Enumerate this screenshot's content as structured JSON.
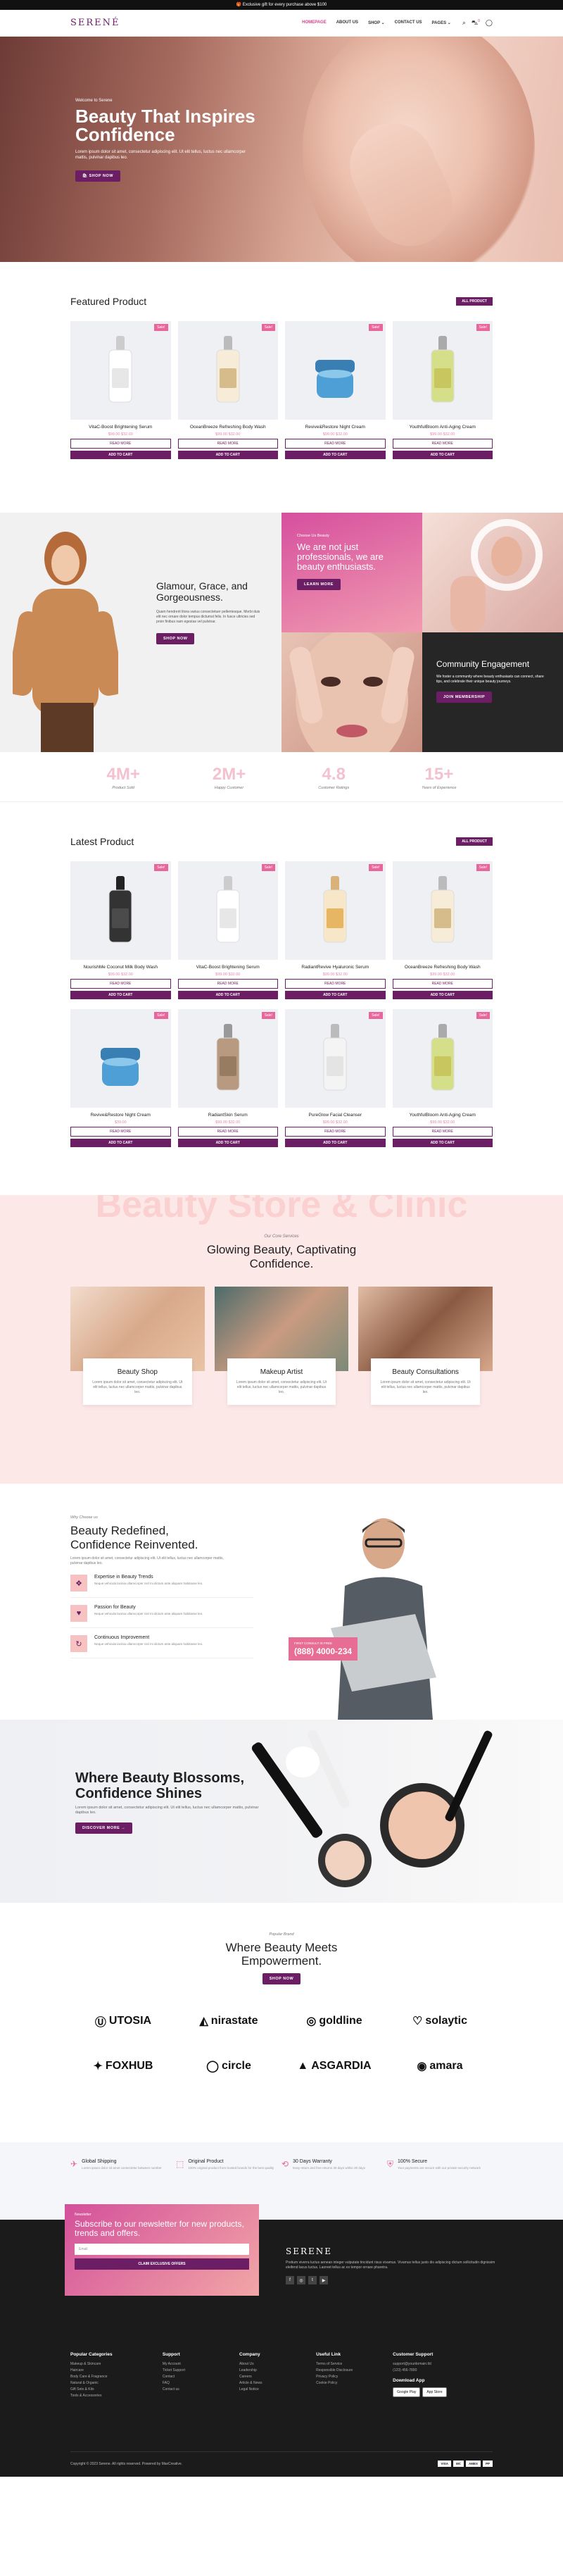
{
  "topbar": {
    "text": "Exclusive gift for every purchase above $100"
  },
  "header": {
    "logo": "SERENÉ",
    "nav": [
      "HOMEPAGE",
      "ABOUT US",
      "SHOP ⌄",
      "CONTACT US",
      "PAGES ⌄"
    ],
    "cart_count": "0"
  },
  "hero": {
    "welcome": "Welcome to Serene",
    "title": "Beauty That Inspires Confidence",
    "desc": "Lorem ipsum dolor sit amet, consectetur adipiscing elit. Ut elit tellus, luctus nec ullamcorper mattis, pulvinar dapibus leo.",
    "cta": "SHOP NOW"
  },
  "featured": {
    "title": "Featured Product",
    "all": "ALL PRODUCT",
    "products": [
      {
        "name": "VitaC-Boost Brightening Serum",
        "price": "$99.00 $32.00",
        "badge": "Sale!"
      },
      {
        "name": "OceanBreeze Refreshing Body Wash",
        "price": "$99.00 $32.00",
        "badge": "Sale!"
      },
      {
        "name": "Revive&Restore Night Cream",
        "price": "$99.00 $32.00",
        "badge": "Sale!"
      },
      {
        "name": "YouthfulBloom Anti-Aging Cream",
        "price": "$99.00 $32.00",
        "badge": "Sale!"
      }
    ],
    "read_more": "READ MORE",
    "add_to_cart": "ADD TO CART"
  },
  "promo": {
    "left_title": "Glamour, Grace, and Gorgeousness.",
    "left_desc": "Quam hendrerit litora varius consectetuer pellentesque. Morbi duis elit nec ornare dolor tempus dictumst felis. In fusce ultricies sed proin finibus nam egestas vel pulvinar.",
    "left_cta": "SHOP NOW",
    "a_small": "Choose Us Beauty",
    "a_title": "We are not just professionals, we are beauty enthusiasts.",
    "a_cta": "LEARN MORE",
    "d_title": "Community Engagement",
    "d_desc": "We foster a community where beauty enthusiasts can connect, share tips, and celebrate their unique beauty journeys.",
    "d_cta": "JOIN MEMBERSHIP"
  },
  "stats": [
    {
      "n": "4M+",
      "l": "Product Sold"
    },
    {
      "n": "2M+",
      "l": "Happy Customer"
    },
    {
      "n": "4.8",
      "l": "Customer Ratings"
    },
    {
      "n": "15+",
      "l": "Years of Experience"
    }
  ],
  "latest": {
    "title": "Latest Product",
    "all": "ALL PRODUCT",
    "products": [
      {
        "name": "NourishMe Coconut Milk Body Wash",
        "price": "$99.00 $32.00",
        "badge": "Sale!"
      },
      {
        "name": "VitaC-Boost Brightening Serum",
        "price": "$99.00 $32.00",
        "badge": "Sale!"
      },
      {
        "name": "RadiantRevive Hyaluronic Serum",
        "price": "$99.00 $32.00",
        "badge": "Sale!"
      },
      {
        "name": "OceanBreeze Refreshing Body Wash",
        "price": "$99.00 $32.00",
        "badge": "Sale!"
      },
      {
        "name": "Revive&Restore Night Cream",
        "price": "$39.00",
        "badge": "Sale!"
      },
      {
        "name": "RadiantSkin Serum",
        "price": "$99.00 $32.00",
        "badge": "Sale!"
      },
      {
        "name": "PureGlow Facial Cleanser",
        "price": "$99.00 $32.00",
        "badge": "Sale!"
      },
      {
        "name": "YouthfulBloom Anti-Aging Cream",
        "price": "$99.00 $32.00",
        "badge": "Sale!"
      }
    ],
    "read_more": "READ MORE",
    "add_to_cart": "ADD TO CART"
  },
  "clinic": {
    "ghost": "Beauty Store & Clinic",
    "sub": "Our Core Services",
    "title": "Glowing Beauty, Captivating Confidence.",
    "services": [
      {
        "name": "Beauty Shop",
        "desc": "Lorem ipsum dolor sit amet, consectetur adipiscing elit. Ut elit tellus, luctus nec ullamcorper mattis, pulvinar dapibus leo."
      },
      {
        "name": "Makeup Artist",
        "desc": "Lorem ipsum dolor sit amet, consectetur adipiscing elit. Ut elit tellus, luctus nec ullamcorper mattis, pulvinar dapibus leo."
      },
      {
        "name": "Beauty Consultations",
        "desc": "Lorem ipsum dolor sit amet, consectetur adipiscing elit. Ut elit tellus, luctus nec ullamcorper mattis, pulvinar dapibus leo."
      }
    ]
  },
  "why": {
    "sub": "Why Choose us",
    "title": "Beauty Redefined, Confidence Reinvented.",
    "desc": "Lorem ipsum dolor sit amet, consectetur adipiscing elit. Ut elit tellus, luctus nec ullamcorper mattis, pulvinar dapibus leo.",
    "items": [
      {
        "t": "Expertise in Beauty Trends",
        "d": "Neque vehicula lacinia ullamcorper nisl mi dictum ante aliquam habitasse leo."
      },
      {
        "t": "Passion for Beauty",
        "d": "Neque vehicula lacinia ullamcorper nisl mi dictum ante aliquam habitasse leo."
      },
      {
        "t": "Continuous Improvement",
        "d": "Neque vehicula lacinia ullamcorper nisl mi dictum ante aliquam habitasse leo."
      }
    ],
    "phone_label": "FIRST CONSULT IS FREE",
    "phone": "(888) 4000-234"
  },
  "blossom": {
    "title": "Where Beauty Blossoms, Confidence Shines",
    "desc": "Lorem ipsum dolor sit amet, consectetur adipiscing elit. Ut elit tellus, luctus nec ullamcorper mattis, pulvinar dapibus leo.",
    "cta": "DISCOVER MORE"
  },
  "brands": {
    "sub": "Popular Brand",
    "title": "Where Beauty Meets Empowerment.",
    "cta": "SHOP NOW",
    "logos": [
      "UTOSIA",
      "nirastate",
      "goldline",
      "solaytic",
      "FOXHUB",
      "circle",
      "ASGARDIA",
      "amara"
    ]
  },
  "features": [
    {
      "t": "Global Shipping",
      "d": "Lorem ipsum dolor sit amet consectetur between number"
    },
    {
      "t": "Original Product",
      "d": "100% original product from trusted brands for the best quality"
    },
    {
      "t": "30 Days Warranty",
      "d": "Easy return and free returns 30 days within 30 days"
    },
    {
      "t": "100% Secure",
      "d": "Your payments are secure with our private security network"
    }
  ],
  "newsletter": {
    "sub": "Newsletter",
    "title": "Subscribe to our newsletter for new products, trends and offers.",
    "placeholder": "Email",
    "cta": "CLAIM EXCLUSIVE OFFERS"
  },
  "footer": {
    "name": "SERENE",
    "desc": "Pretium viverra luctus aenean integer vulputate tincidunt risus vivamus. Vivamus tellus justo dis adipiscing dictum sollicitudin dignissim eleifend lacus luctus. Laoreet tellus ac ex tempor ornare pharetra.",
    "cols": [
      {
        "h": "Popular Categories",
        "items": [
          "Makeup & Skincare",
          "Haircare",
          "Body Care & Fragrance",
          "Natural & Organic",
          "Gift Sets & Kits",
          "Tools & Accessories"
        ]
      },
      {
        "h": "Support",
        "items": [
          "My Account",
          "Ticket Support",
          "Contact",
          "FAQ",
          "Contact us"
        ]
      },
      {
        "h": "Company",
        "items": [
          "About Us",
          "Leadership",
          "Careers",
          "Article & News",
          "Legal Notice"
        ]
      },
      {
        "h": "Useful Link",
        "items": [
          "Terms of Service",
          "Responsible Disclosure",
          "Privacy Policy",
          "Cookie Policy"
        ]
      },
      {
        "h": "Customer Support",
        "items": [
          "support@yourdomain.tld",
          "(123) 456-7890"
        ]
      }
    ],
    "download": "Download App",
    "google": "Google Play",
    "apple": "App Store",
    "copyright": "Copyright © 2023 Serene. All rights reserved. Powered by MaxCreative.",
    "payments": [
      "VISA",
      "MC",
      "AMEX",
      "PP"
    ]
  }
}
